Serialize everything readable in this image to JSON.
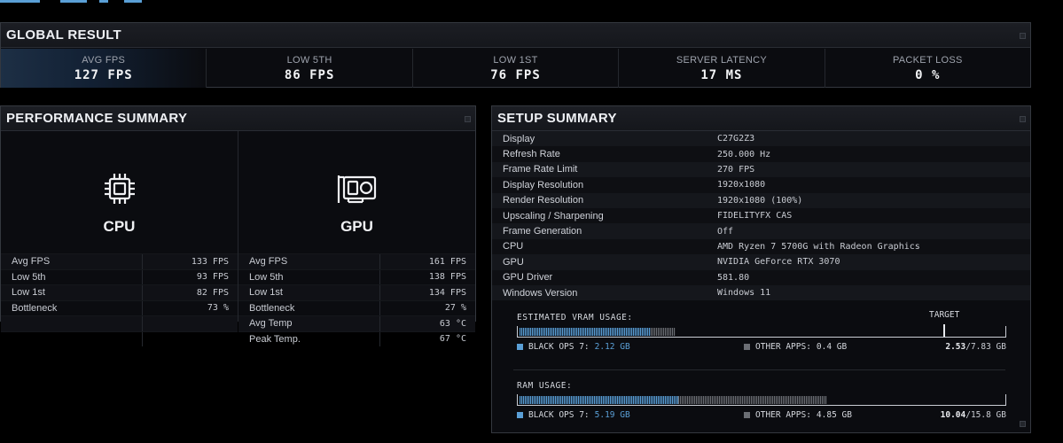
{
  "global_result": {
    "title": "GLOBAL RESULT",
    "metrics": [
      {
        "label": "AVG FPS",
        "value": "127 FPS"
      },
      {
        "label": "LOW 5TH",
        "value": "86 FPS"
      },
      {
        "label": "LOW 1ST",
        "value": "76 FPS"
      },
      {
        "label": "SERVER LATENCY",
        "value": "17 MS"
      },
      {
        "label": "PACKET LOSS",
        "value": "0 %"
      }
    ]
  },
  "performance_summary": {
    "title": "PERFORMANCE SUMMARY",
    "cpu": {
      "title": "CPU",
      "icon": "cpu-chip-icon",
      "stats": [
        {
          "name": "Avg FPS",
          "value": "133 FPS"
        },
        {
          "name": "Low 5th",
          "value": "93 FPS"
        },
        {
          "name": "Low 1st",
          "value": "82 FPS"
        },
        {
          "name": "Bottleneck",
          "value": "73 %"
        }
      ]
    },
    "gpu": {
      "title": "GPU",
      "icon": "graphics-card-icon",
      "stats": [
        {
          "name": "Avg FPS",
          "value": "161 FPS"
        },
        {
          "name": "Low 5th",
          "value": "138 FPS"
        },
        {
          "name": "Low 1st",
          "value": "134 FPS"
        },
        {
          "name": "Bottleneck",
          "value": "27 %"
        },
        {
          "name": "Avg Temp",
          "value": "63 °C"
        },
        {
          "name": "Peak Temp.",
          "value": "67 °C"
        }
      ]
    }
  },
  "setup_summary": {
    "title": "SETUP SUMMARY",
    "rows": [
      {
        "key": "Display",
        "value": "C27G2Z3"
      },
      {
        "key": "Refresh Rate",
        "value": "250.000 Hz"
      },
      {
        "key": "Frame Rate Limit",
        "value": "270 FPS"
      },
      {
        "key": "Display Resolution",
        "value": "1920x1080"
      },
      {
        "key": "Render Resolution",
        "value": "1920x1080 (100%)"
      },
      {
        "key": "Upscaling / Sharpening",
        "value": "FIDELITYFX CAS"
      },
      {
        "key": "Frame Generation",
        "value": "Off"
      },
      {
        "key": "CPU",
        "value": "AMD Ryzen 7 5700G with Radeon Graphics"
      },
      {
        "key": "GPU",
        "value": "NVIDIA GeForce RTX 3070"
      },
      {
        "key": "GPU Driver",
        "value": "581.80"
      },
      {
        "key": "Windows Version",
        "value": "Windows 11"
      }
    ],
    "vram": {
      "label": "ESTIMATED VRAM USAGE:",
      "target_label": "TARGET",
      "own_label": "BLACK OPS 7:",
      "own_value": "2.12 GB",
      "other_label": "OTHER APPS:",
      "other_value": "0.4 GB",
      "total_used": "2.53",
      "total_capacity": "/7.83 GB",
      "own_gb": 2.12,
      "other_gb": 0.4,
      "capacity_gb": 7.83,
      "target_fraction": 0.88
    },
    "ram": {
      "label": "RAM USAGE:",
      "own_label": "BLACK OPS 7:",
      "own_value": "5.19 GB",
      "other_label": "OTHER APPS:",
      "other_value": "4.85 GB",
      "total_used": "10.04",
      "total_capacity": "/15.8 GB",
      "own_gb": 5.19,
      "other_gb": 4.85,
      "capacity_gb": 15.8
    }
  },
  "colors": {
    "accent_blue": "#5a9fd6",
    "other_gray": "#6b6e74"
  }
}
